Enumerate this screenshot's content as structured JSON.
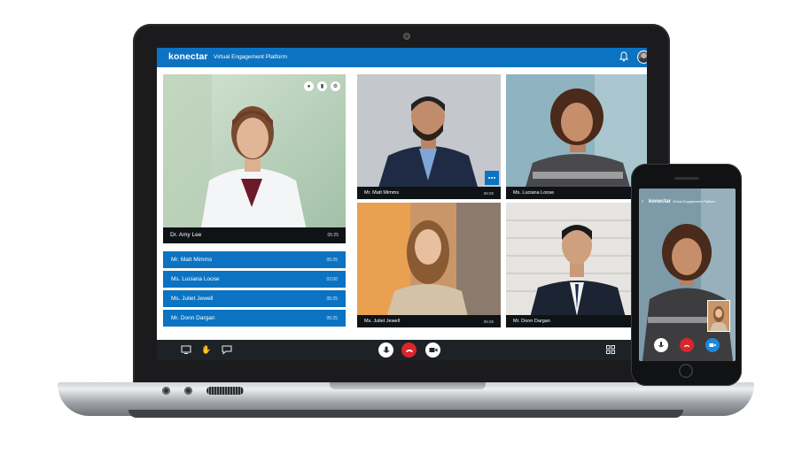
{
  "app": {
    "brand": "konectar",
    "subtitle": "Virtual Engagement Platform"
  },
  "main_participant": {
    "name": "Dr. Amy Lee",
    "time": "05:25"
  },
  "roster": [
    {
      "name": "Mr. Matt Mimms",
      "time": "05:25"
    },
    {
      "name": "Ms. Luciana Loose",
      "time": "02:00"
    },
    {
      "name": "Ms. Juliet Jewell",
      "time": "05:25"
    },
    {
      "name": "Mr. Donn Dargan",
      "time": "05:25"
    }
  ],
  "tiles": [
    {
      "name": "Mr. Matt Mimms",
      "time": "05:25"
    },
    {
      "name": "Ms. Luciana Loose",
      "time": ""
    },
    {
      "name": "Ms. Juliet Jewell",
      "time": "05:25"
    },
    {
      "name": "Mr. Donn Dargan",
      "time": ""
    }
  ],
  "phone": {
    "brand": "konectar",
    "subtitle": "Virtual Engagement Platform",
    "back": "‹"
  },
  "icons": {
    "header": [
      "bell-icon",
      "user-avatar"
    ],
    "panel": [
      "person-icon",
      "chat-icon",
      "gear-icon"
    ],
    "controls_left": [
      "screen-share-icon",
      "raise-hand-icon",
      "chat-icon"
    ],
    "controls_center": [
      "microphone-icon",
      "hang-up-icon",
      "camera-icon"
    ],
    "controls_right": [
      "grid-view-icon"
    ]
  },
  "colors": {
    "accent": "#0b73c2",
    "danger": "#d9262c",
    "bar": "#0f1316"
  }
}
